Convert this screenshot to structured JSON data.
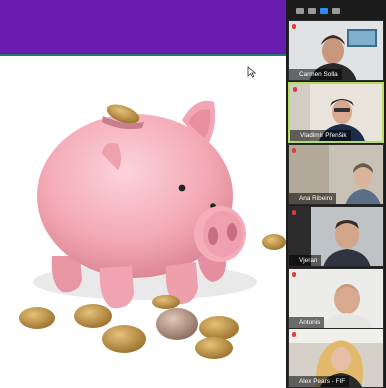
{
  "screen_share": {
    "subject": "piggy bank with coins"
  },
  "participants": [
    {
      "name": "Carmen Solla",
      "speaking": false
    },
    {
      "name": "Vladimír Přenšik",
      "speaking": true
    },
    {
      "name": "Ana Ribeiro",
      "speaking": false
    },
    {
      "name": "Vjeran",
      "speaking": false
    },
    {
      "name": "Antonis",
      "speaking": false
    },
    {
      "name": "Alex Pears - FIF",
      "speaking": false
    }
  ],
  "colors": {
    "banner": "#6a1bb0",
    "active_speaker": "#b6e05a",
    "piggy": "#f3a9b5"
  },
  "icons": {
    "toolbar": [
      "view-toggle-icon",
      "gallery-icon",
      "speaker-view-icon",
      "grid-icon"
    ]
  }
}
